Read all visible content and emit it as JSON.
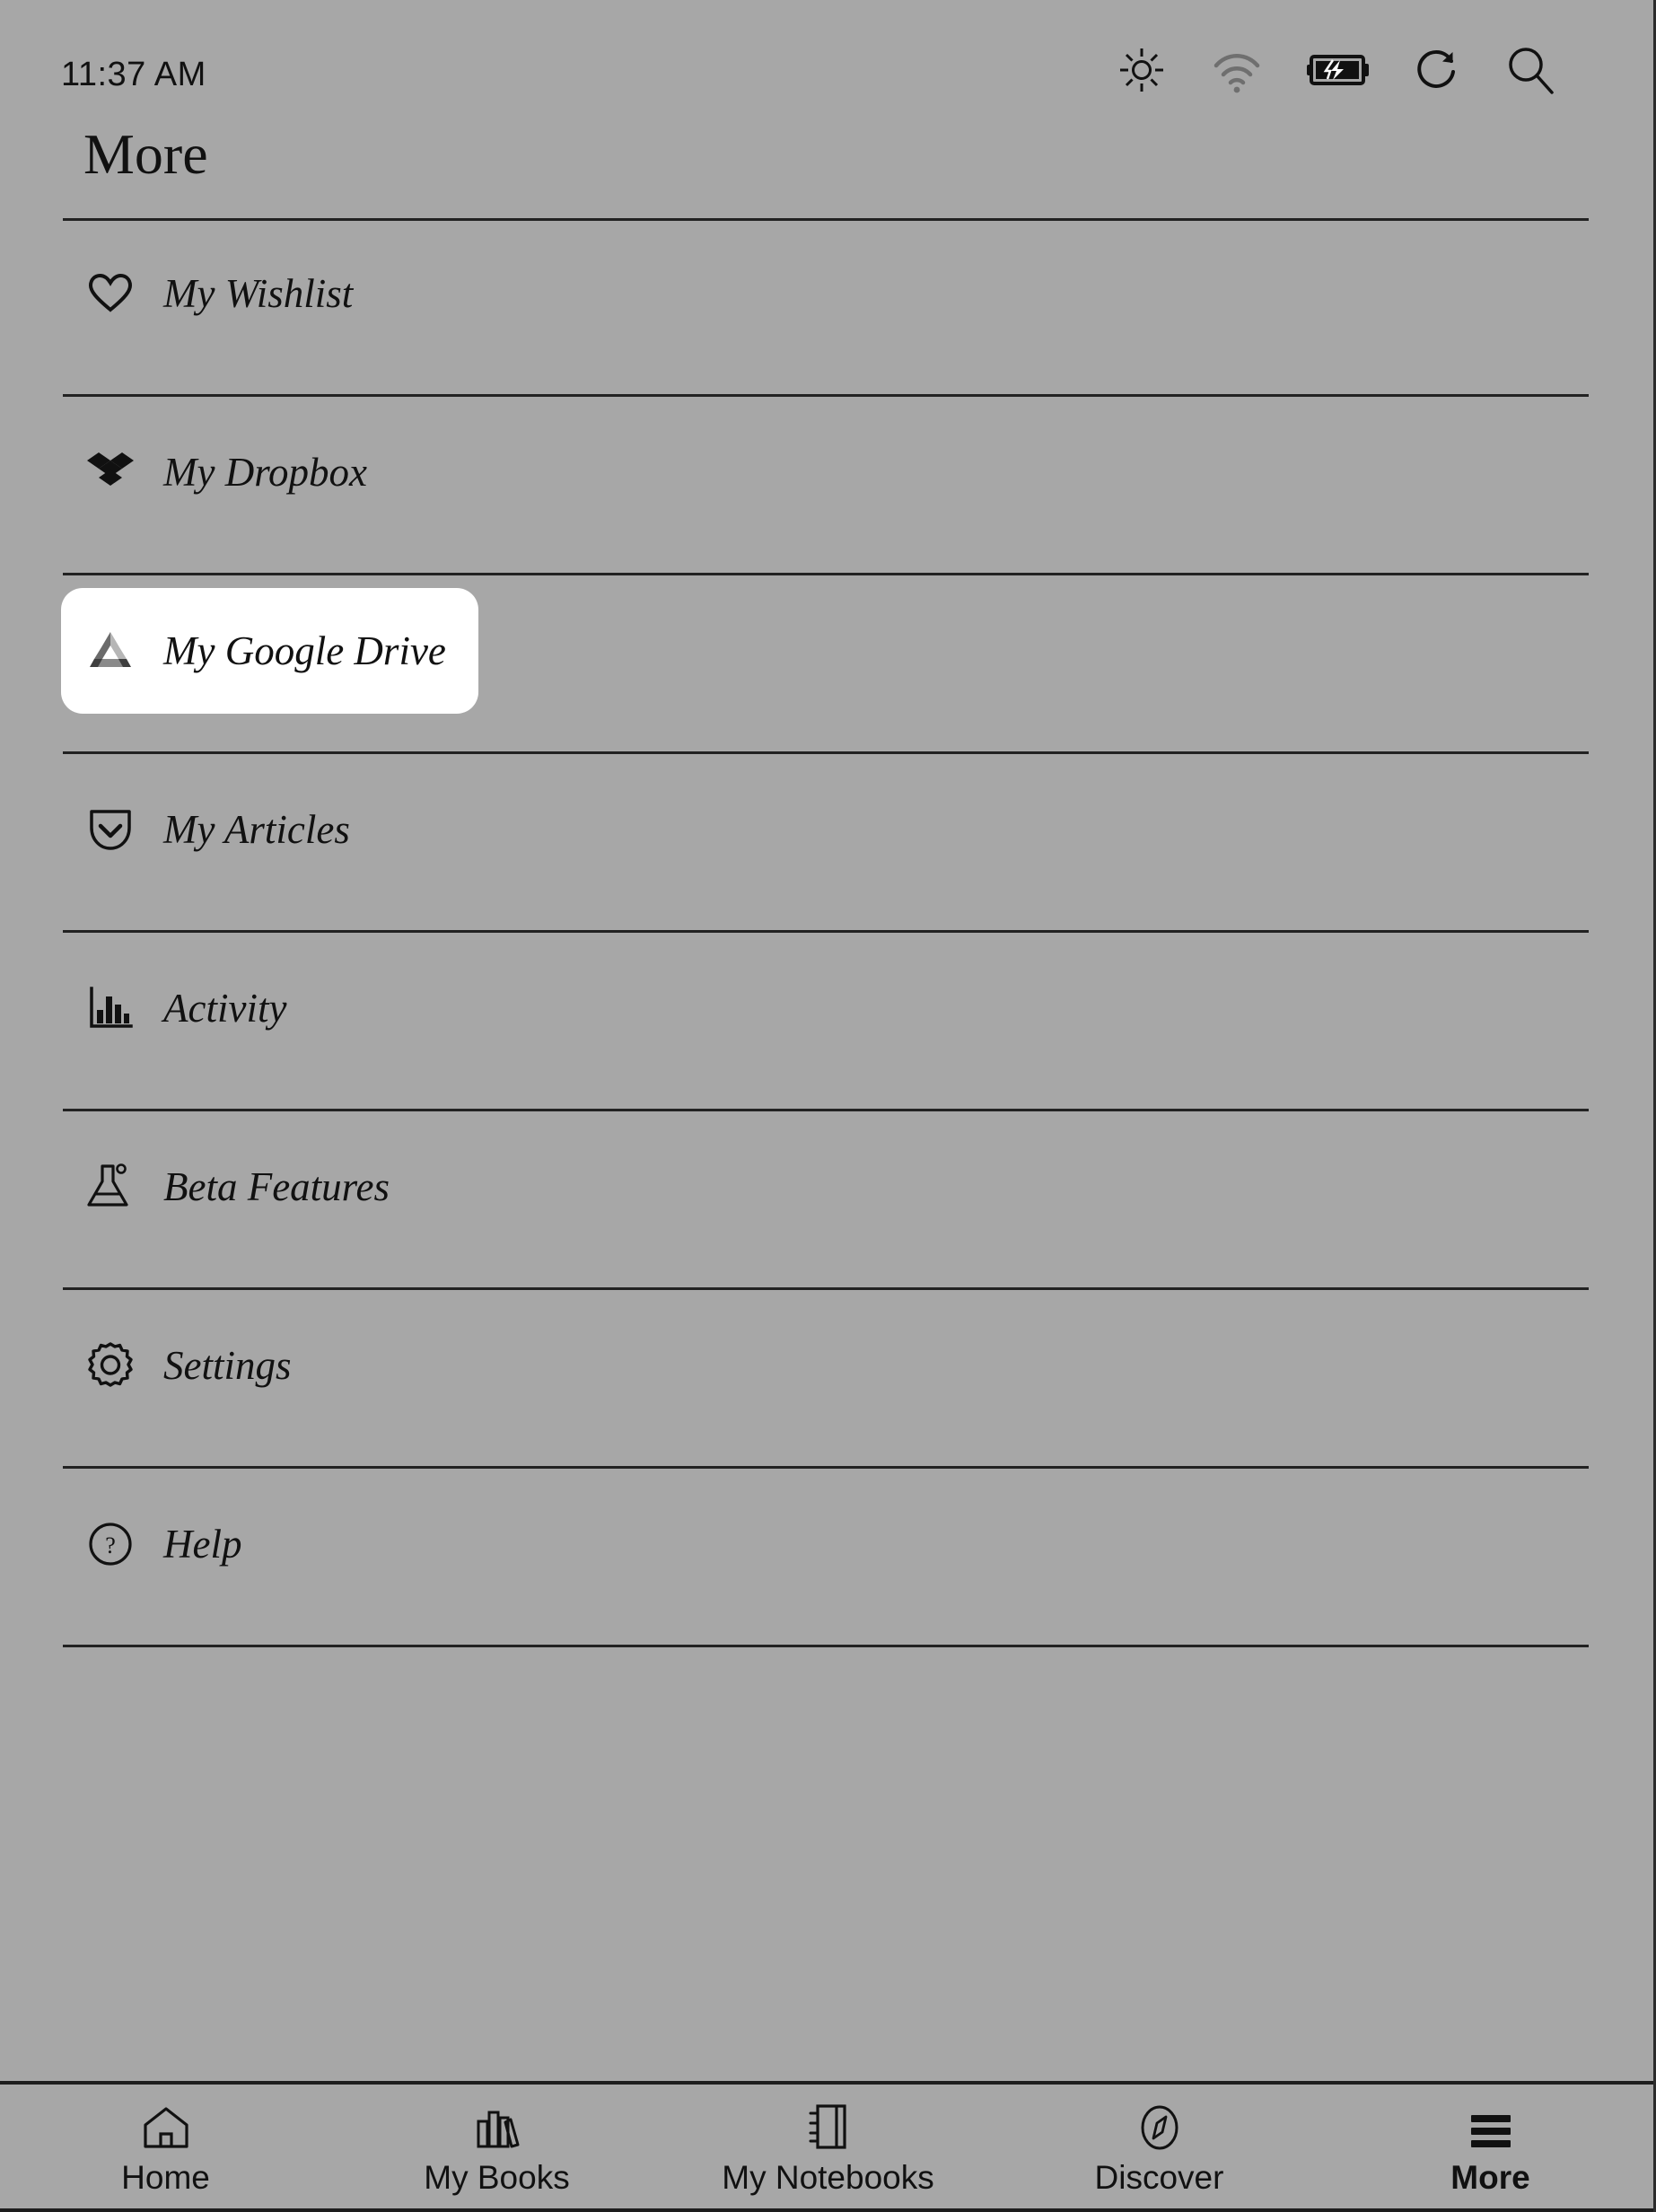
{
  "status_bar": {
    "time": "11:37 AM",
    "icons": [
      {
        "name": "brightness-icon",
        "label": "Brightness"
      },
      {
        "name": "wifi-icon",
        "label": "Wi-Fi"
      },
      {
        "name": "battery-charging-icon",
        "label": "Battery charging"
      },
      {
        "name": "sync-icon",
        "label": "Sync"
      },
      {
        "name": "search-icon",
        "label": "Search"
      }
    ]
  },
  "header": {
    "title": "More"
  },
  "menu": {
    "items": [
      {
        "label": "My Wishlist",
        "icon": "heart-icon",
        "selected": false
      },
      {
        "label": "My Dropbox",
        "icon": "dropbox-icon",
        "selected": false
      },
      {
        "label": "My Google Drive",
        "icon": "google-drive-icon",
        "selected": true
      },
      {
        "label": "My Articles",
        "icon": "pocket-icon",
        "selected": false
      },
      {
        "label": "Activity",
        "icon": "bar-chart-icon",
        "selected": false
      },
      {
        "label": "Beta Features",
        "icon": "flask-icon",
        "selected": false
      },
      {
        "label": "Settings",
        "icon": "gear-icon",
        "selected": false
      },
      {
        "label": "Help",
        "icon": "question-circle-icon",
        "selected": false
      }
    ]
  },
  "bottom_nav": {
    "tabs": [
      {
        "label": "Home",
        "icon": "house-icon",
        "active": false
      },
      {
        "label": "My Books",
        "icon": "books-icon",
        "active": false
      },
      {
        "label": "My Notebooks",
        "icon": "notebook-icon",
        "active": false
      },
      {
        "label": "Discover",
        "icon": "compass-icon",
        "active": false
      },
      {
        "label": "More",
        "icon": "hamburger-icon",
        "active": true
      }
    ]
  },
  "colors": {
    "background": "#a7a7a7",
    "foreground": "#111111",
    "selected_background": "#ffffff",
    "divider": "#222222",
    "disabled_icon": "#6f6f6f"
  }
}
